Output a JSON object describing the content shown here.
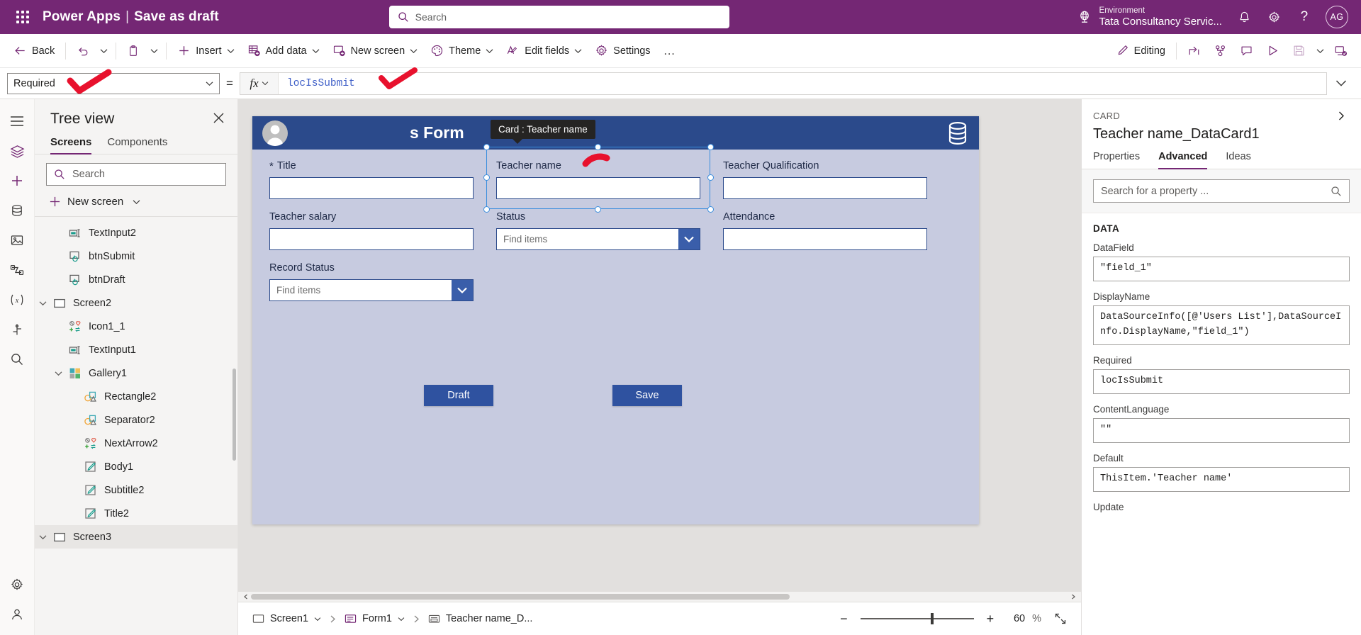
{
  "topbar": {
    "waffle": "app-launcher",
    "brand": "Power Apps",
    "brand_separator": "|",
    "app_name": "Save as draft",
    "search_placeholder": "Search",
    "environment_label": "Environment",
    "environment_name": "Tata Consultancy Servic...",
    "notifications": "bell-icon",
    "settings": "gear-icon",
    "help": "?",
    "avatar_initials": "AG"
  },
  "commandbar": {
    "back": "Back",
    "undo": "undo-icon",
    "paste": "paste-icon",
    "insert": "Insert",
    "add_data": "Add data",
    "new_screen": "New screen",
    "theme": "Theme",
    "edit_fields": "Edit fields",
    "settings": "Settings",
    "overflow": "…",
    "editing": "Editing"
  },
  "formulabar": {
    "property": "Required",
    "equals": "=",
    "fx": "fx",
    "formula": "locIsSubmit"
  },
  "treeview": {
    "title": "Tree view",
    "close": "close-icon",
    "tabs": [
      {
        "label": "Screens",
        "active": true
      },
      {
        "label": "Components",
        "active": false
      }
    ],
    "search_placeholder": "Search",
    "new_screen": "New screen",
    "items": [
      {
        "label": "TextInput2",
        "icon": "textinput-icon",
        "depth": 2,
        "caret": "none"
      },
      {
        "label": "btnSubmit",
        "icon": "button-icon",
        "depth": 2,
        "caret": "none"
      },
      {
        "label": "btnDraft",
        "icon": "button-icon",
        "depth": 2,
        "caret": "none"
      },
      {
        "label": "Screen2",
        "icon": "screen-icon",
        "depth": 1,
        "caret": "down"
      },
      {
        "label": "Icon1_1",
        "icon": "icon-shape-icon",
        "depth": 2,
        "caret": "none"
      },
      {
        "label": "TextInput1",
        "icon": "textinput-icon",
        "depth": 2,
        "caret": "none"
      },
      {
        "label": "Gallery1",
        "icon": "gallery-icon",
        "depth": 2,
        "caret": "down"
      },
      {
        "label": "Rectangle2",
        "icon": "shape-icon",
        "depth": 3,
        "caret": "none"
      },
      {
        "label": "Separator2",
        "icon": "shape-icon",
        "depth": 3,
        "caret": "none"
      },
      {
        "label": "NextArrow2",
        "icon": "icon-shape-icon",
        "depth": 3,
        "caret": "none"
      },
      {
        "label": "Body1",
        "icon": "label-icon",
        "depth": 3,
        "caret": "none"
      },
      {
        "label": "Subtitle2",
        "icon": "label-icon",
        "depth": 3,
        "caret": "none"
      },
      {
        "label": "Title2",
        "icon": "label-icon",
        "depth": 3,
        "caret": "none"
      },
      {
        "label": "Screen3",
        "icon": "screen-icon",
        "depth": 1,
        "caret": "down"
      }
    ]
  },
  "canvas": {
    "app_title": "s Form",
    "header_avatar": "person-avatar",
    "header_data_icon": "database-icon",
    "tooltip": "Card : Teacher name",
    "fields": [
      {
        "label": "Title",
        "required": true,
        "type": "input",
        "value": "",
        "placeholder": ""
      },
      {
        "label": "Teacher name",
        "required": false,
        "type": "input",
        "value": "",
        "placeholder": "",
        "selected": true
      },
      {
        "label": "Teacher Qualification",
        "required": false,
        "type": "input",
        "value": "",
        "placeholder": ""
      },
      {
        "label": "Teacher salary",
        "required": false,
        "type": "input",
        "value": "",
        "placeholder": ""
      },
      {
        "label": "Status",
        "required": false,
        "type": "dropdown",
        "value": "",
        "placeholder": "Find items"
      },
      {
        "label": "Attendance",
        "required": false,
        "type": "input",
        "value": "",
        "placeholder": ""
      },
      {
        "label": "Record Status",
        "required": false,
        "type": "dropdown",
        "value": "",
        "placeholder": "Find items"
      }
    ],
    "buttons": [
      {
        "label": "Draft",
        "name": "draft-button"
      },
      {
        "label": "Save",
        "name": "save-button"
      }
    ]
  },
  "statusbar": {
    "screen": "Screen1",
    "form": "Form1",
    "control": "Teacher name_D...",
    "zoom_out": "−",
    "zoom_in": "+",
    "zoom_value": "60",
    "zoom_unit": "%",
    "fit": "fit-screen-icon"
  },
  "properties": {
    "kicker": "CARD",
    "title": "Teacher name_DataCard1",
    "expand": "chevron-right-icon",
    "tabs": [
      {
        "label": "Properties",
        "active": false
      },
      {
        "label": "Advanced",
        "active": true
      },
      {
        "label": "Ideas",
        "active": false
      }
    ],
    "search_placeholder": "Search for a property ...",
    "section": "DATA",
    "fields": [
      {
        "label": "DataField",
        "value": "\"field_1\""
      },
      {
        "label": "DisplayName",
        "value": "DataSourceInfo([@'Users List'],DataSourceInfo.DisplayName,\"field_1\")"
      },
      {
        "label": "Required",
        "value": "locIsSubmit"
      },
      {
        "label": "ContentLanguage",
        "value": "\"\""
      },
      {
        "label": "Default",
        "value": "ThisItem.'Teacher name'"
      },
      {
        "label": "Update",
        "value": ""
      }
    ]
  },
  "colors": {
    "brand_purple": "#742774",
    "form_header_blue": "#2b4a8b",
    "form_bg": "#c7cbe0",
    "selection_blue": "#3a8ede",
    "annotation_red": "#e8112d"
  }
}
